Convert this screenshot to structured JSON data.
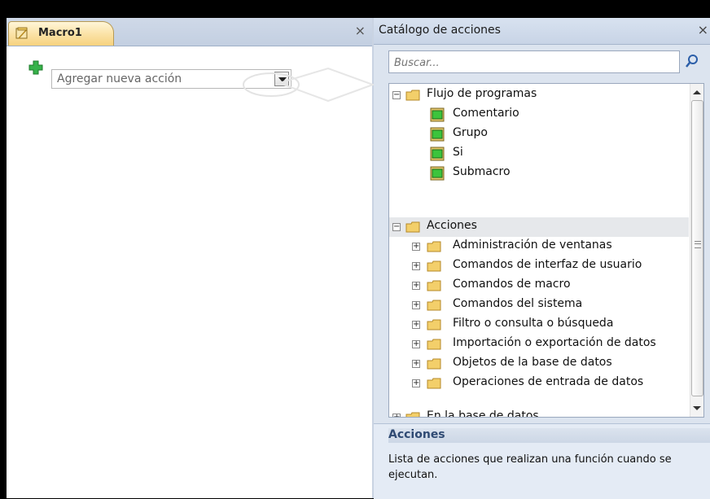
{
  "macro_tab": {
    "label": "Macro1",
    "close": "×"
  },
  "macro": {
    "add_action_placeholder": "Agregar nueva acción"
  },
  "catalog": {
    "title": "Catálogo de acciones",
    "close": "×",
    "search_placeholder": "Buscar...",
    "groups": [
      {
        "label": "Flujo de programas",
        "expanded": true,
        "items": [
          "Comentario",
          "Grupo",
          "Si",
          "Submacro"
        ]
      },
      {
        "label": "Acciones",
        "expanded": true,
        "selected": true,
        "items": [
          "Administración de ventanas",
          "Comandos de interfaz de usuario",
          "Comandos de macro",
          "Comandos del sistema",
          "Filtro o consulta o búsqueda",
          "Importación o exportación de datos",
          "Objetos de la base de datos",
          "Operaciones de entrada de datos"
        ]
      },
      {
        "label": "En la base de datos",
        "expanded": false,
        "items": []
      }
    ],
    "expand_symbol": "+",
    "collapse_symbol": "−"
  },
  "description": {
    "title": "Acciones",
    "text": "Lista de acciones que realizan una función cuando se ejecutan."
  },
  "colors": {
    "tab_active": "#fbe3a8",
    "folder": "#f3cf6a",
    "green_item": "#3cc43c"
  }
}
